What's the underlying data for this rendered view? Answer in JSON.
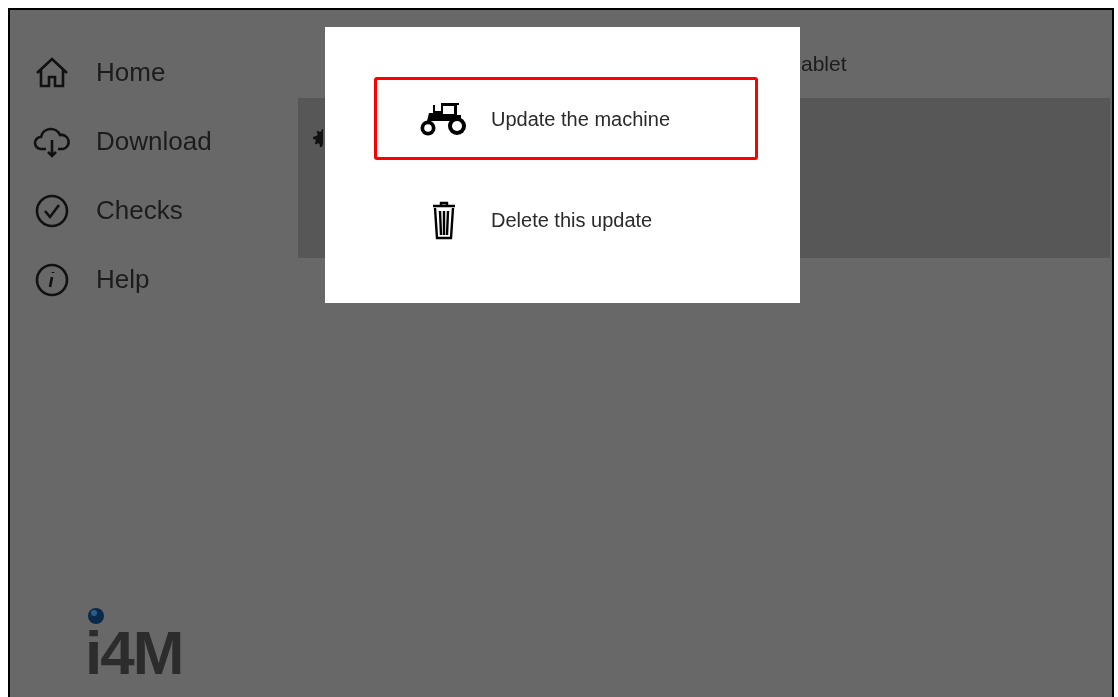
{
  "sidebar": {
    "items": [
      {
        "kind": "home",
        "label": "Home"
      },
      {
        "kind": "download",
        "label": "Download"
      },
      {
        "kind": "check",
        "label": "Checks"
      },
      {
        "kind": "info",
        "label": "Help"
      }
    ],
    "logo": "i4M"
  },
  "header": {
    "title": "ablet"
  },
  "dialog": {
    "options": [
      {
        "kind": "tractor",
        "label": "Update the machine",
        "selected": true
      },
      {
        "kind": "trash",
        "label": "Delete this update",
        "selected": false
      }
    ]
  }
}
